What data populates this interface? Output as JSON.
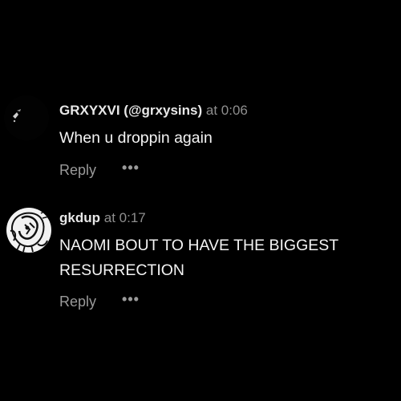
{
  "comments": [
    {
      "username": "GRXYXVI (@grxysins)",
      "timestamp": "at 0:06",
      "text": "When u droppin again",
      "reply_label": "Reply",
      "more_label": "•••"
    },
    {
      "username": "gkdup",
      "timestamp": "at 0:17",
      "text": "NAOMI BOUT TO HAVE THE BIGGEST RESURRECTION",
      "reply_label": "Reply",
      "more_label": "•••"
    }
  ],
  "colors": {
    "background": "#000000",
    "text": "#f4f4f4",
    "muted": "#8e8e8e"
  },
  "icons": {
    "avatar_1": "abstract-dark-avatar-icon",
    "avatar_2": "sketch-portrait-avatar-icon",
    "more": "more-options-icon"
  }
}
